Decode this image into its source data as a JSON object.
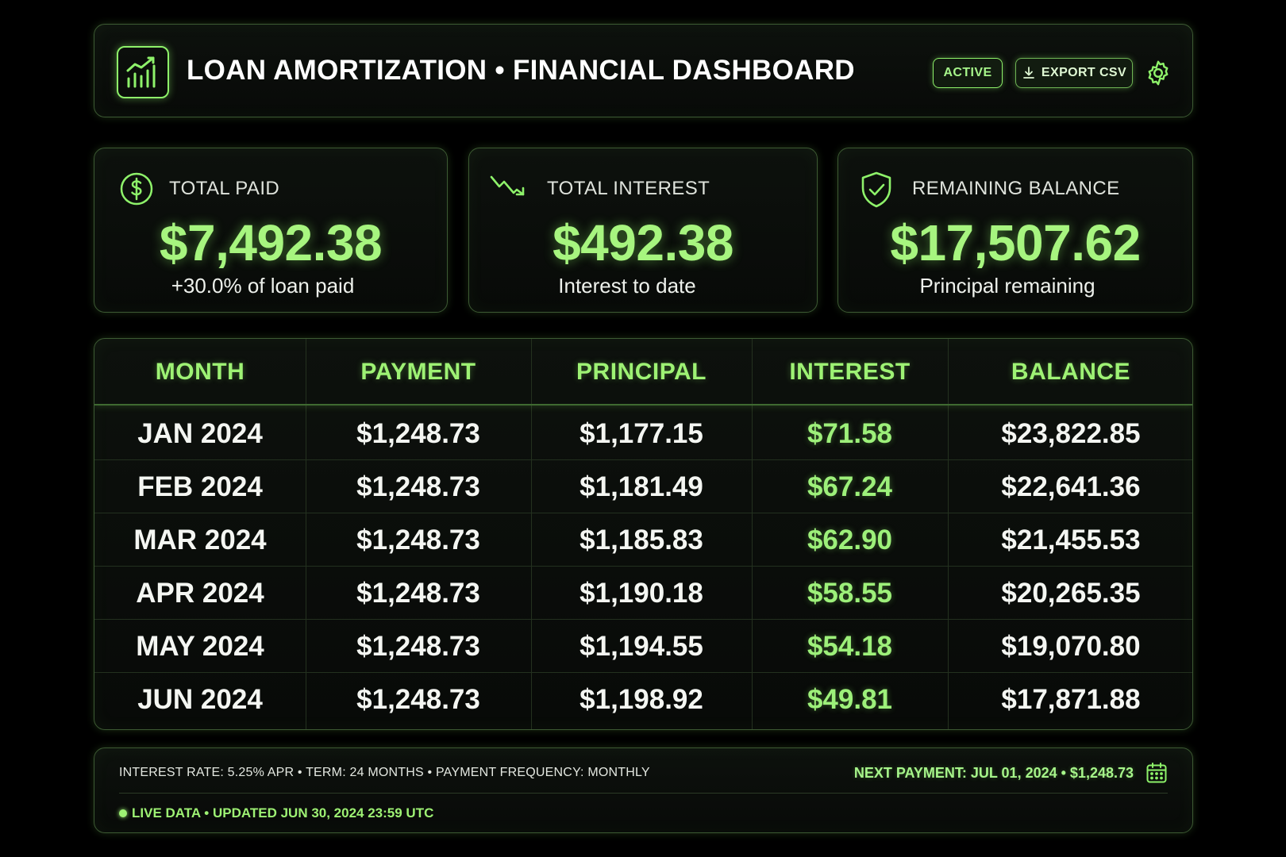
{
  "header": {
    "title": "LOAN AMORTIZATION • FINANCIAL DASHBOARD",
    "status_label": "ACTIVE",
    "export_label": "EXPORT CSV",
    "logo_icon": "chart-growth-icon",
    "settings_icon": "gear-icon"
  },
  "cards": [
    {
      "label": "TOTAL PAID",
      "value": "$7,492.38",
      "sub": "+30.0% of loan paid",
      "icon": "dollar-circle-icon"
    },
    {
      "label": "TOTAL INTEREST",
      "value": "$492.38",
      "sub": "Interest to date",
      "icon": "trend-down-icon"
    },
    {
      "label": "REMAINING BALANCE",
      "value": "$17,507.62",
      "sub": "Principal remaining",
      "icon": "shield-check-icon"
    }
  ],
  "table": {
    "columns": [
      "MONTH",
      "PAYMENT",
      "PRINCIPAL",
      "INTEREST",
      "BALANCE"
    ],
    "rows": [
      [
        "JAN 2024",
        "$1,248.73",
        "$1,177.15",
        "$71.58",
        "$23,822.85"
      ],
      [
        "FEB 2024",
        "$1,248.73",
        "$1,181.49",
        "$67.24",
        "$22,641.36"
      ],
      [
        "MAR 2024",
        "$1,248.73",
        "$1,185.83",
        "$62.90",
        "$21,455.53"
      ],
      [
        "APR 2024",
        "$1,248.73",
        "$1,190.18",
        "$58.55",
        "$20,265.35"
      ],
      [
        "MAY 2024",
        "$1,248.73",
        "$1,194.55",
        "$54.18",
        "$19,070.80"
      ],
      [
        "JUN 2024",
        "$1,248.73",
        "$1,198.92",
        "$49.81",
        "$17,871.88"
      ]
    ]
  },
  "footer": {
    "terms": "INTEREST RATE: 5.25% APR • TERM: 24 MONTHS • PAYMENT FREQUENCY: MONTHLY",
    "next_payment": "NEXT PAYMENT: JUL 01, 2024 • $1,248.73",
    "live": "LIVE DATA • UPDATED JUN 30, 2024 23:59 UTC",
    "calendar_icon": "calendar-icon"
  },
  "colors": {
    "accent": "#9ef274",
    "background": "#000000",
    "panel_border": "#3d5a33",
    "text": "#f4f6f2"
  }
}
